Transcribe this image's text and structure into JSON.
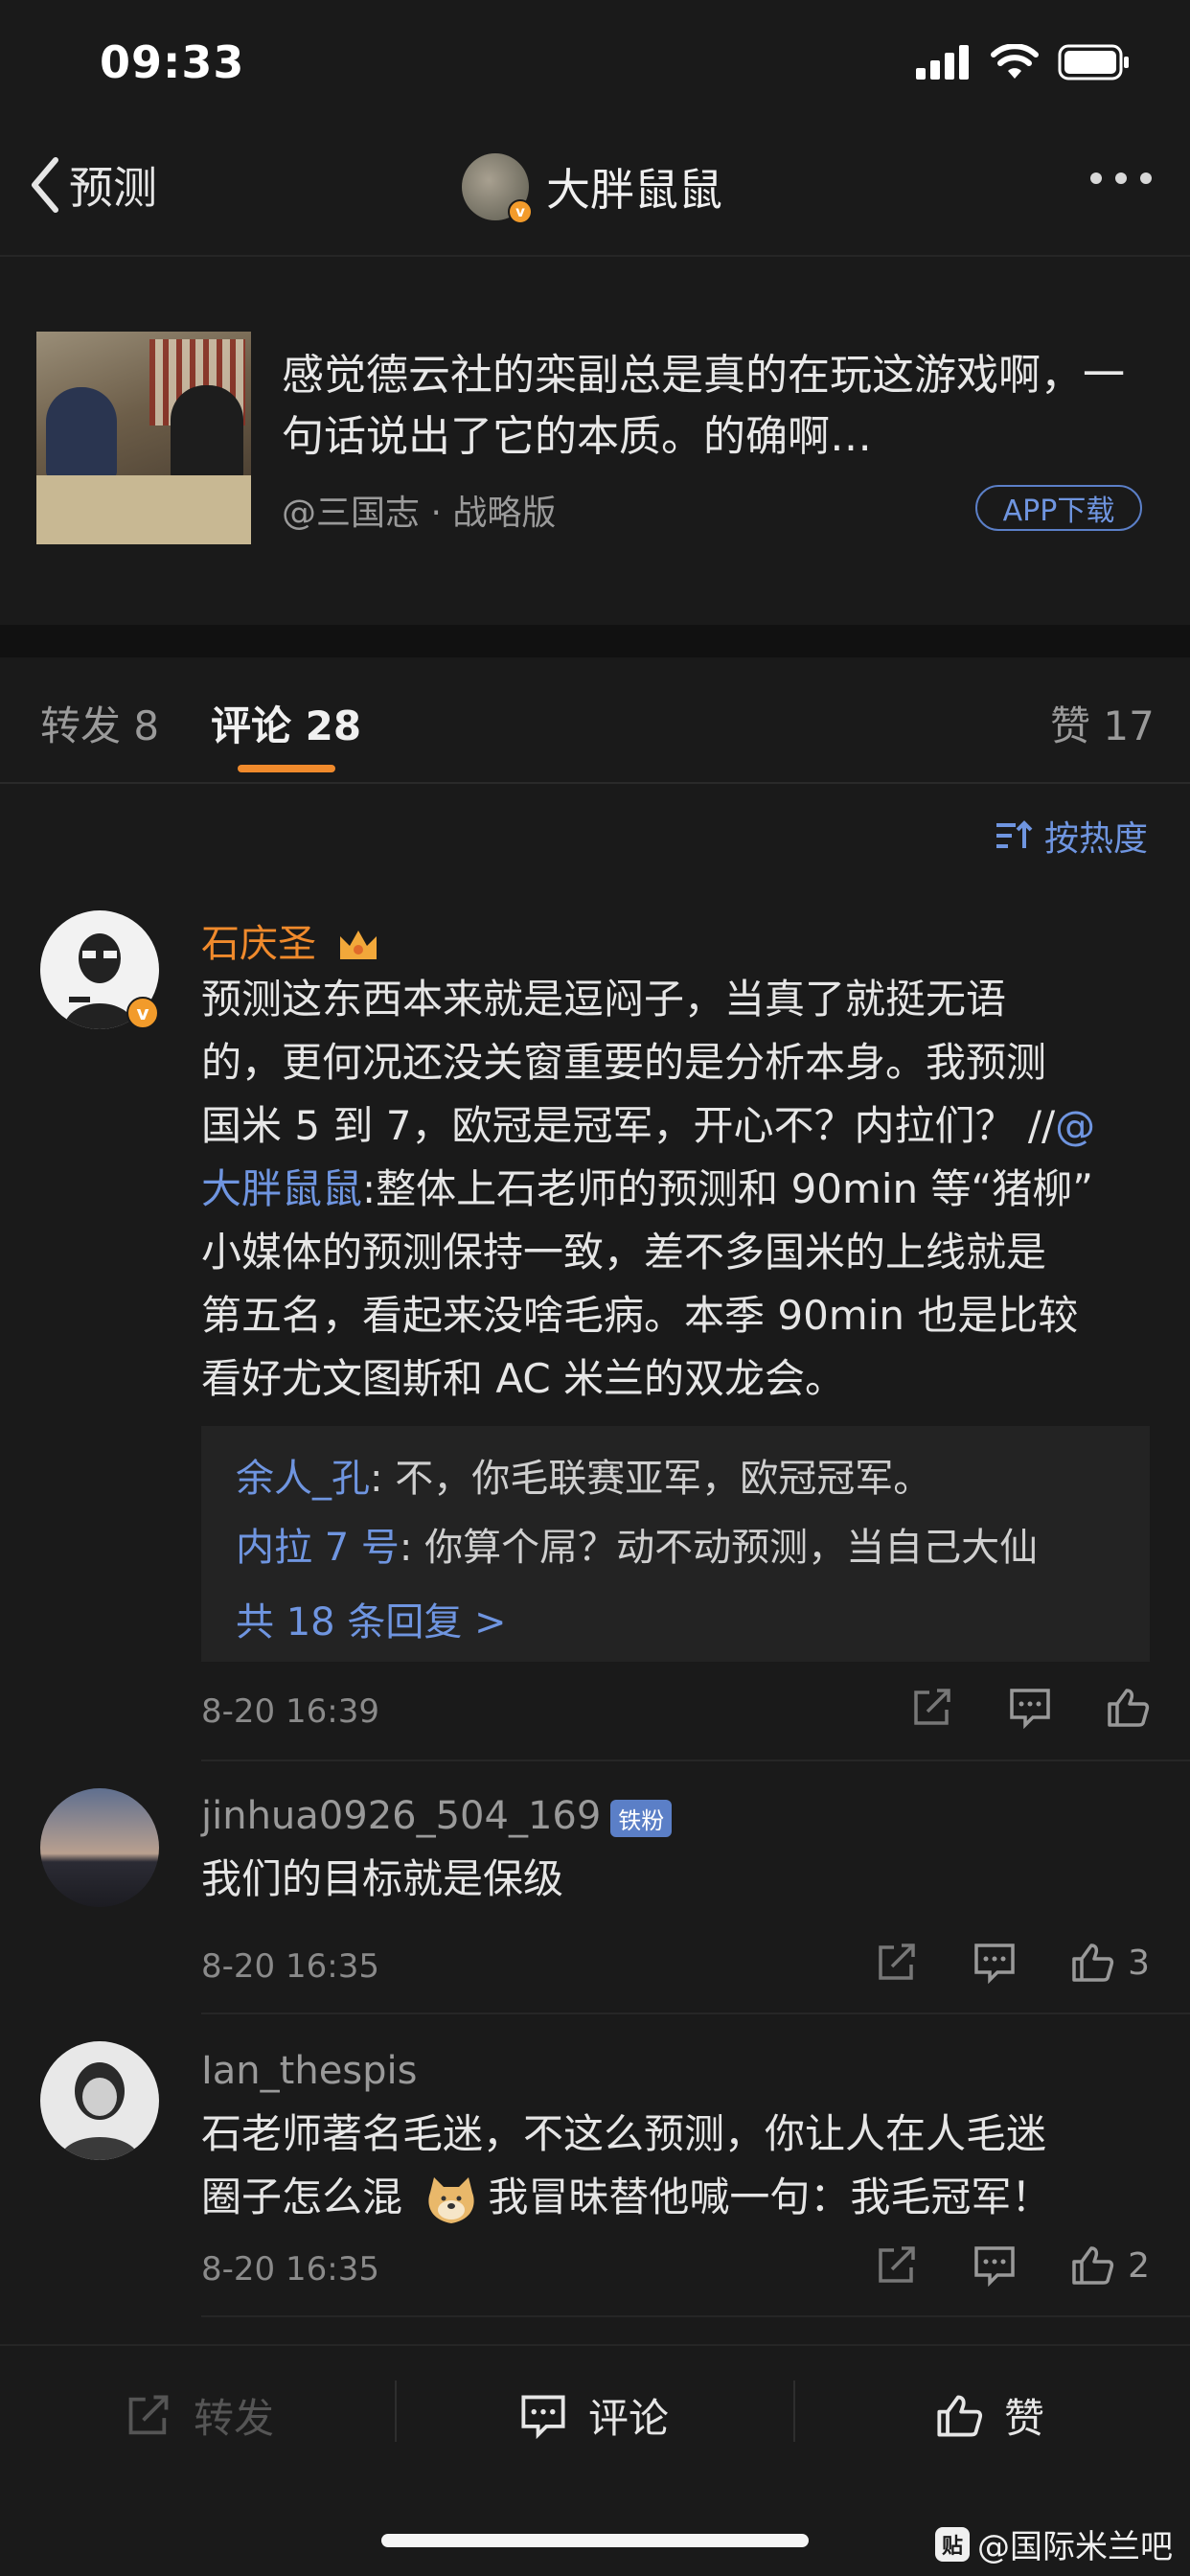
{
  "status": {
    "time": "09:33"
  },
  "nav": {
    "back_label": "预测",
    "username": "大胖鼠鼠"
  },
  "card": {
    "text": "感觉德云社的栾副总是真的在玩这游戏啊，一句话说出了它的本质。的确啊…",
    "source": "@三国志 · 战略版",
    "app_button": "APP下载"
  },
  "tabs": {
    "repost": "转发 8",
    "comments": "评论 28",
    "likes": "赞 17"
  },
  "sort": {
    "label": "按热度"
  },
  "comments": [
    {
      "name": "石庆圣",
      "body_lines": [
        "预测这东西本来就是逗闷子，当真了就挺无语",
        "的，更何况还没关窗重要的是分析本身。我预测",
        "国米 5 到 7，欧冠是冠军，开心不？内拉们？ //",
        "大胖鼠鼠",
        ":整体上石老师的预测和 90min 等“猪柳”",
        "小媒体的预测保持一致，差不多国米的上线就是",
        "第五名，看起来没啥毛病。本季 90min 也是比较",
        "看好尤文图斯和 AC 米兰的双龙会。"
      ],
      "mention_prefix": "@",
      "replies": [
        {
          "who": "余人_孔",
          "text": ": 不，你毛联赛亚军，欧冠冠军。"
        },
        {
          "who": "内拉 7 号",
          "text": ": 你算个屌？动不动预测，当自己大仙"
        }
      ],
      "more_replies": "共 18 条回复 >",
      "time": "8-20 16:39"
    },
    {
      "name": "jinhua0926_504_169",
      "badge": "铁粉",
      "body": "我们的目标就是保级",
      "time": "8-20 16:35",
      "likes": "3"
    },
    {
      "name": "Ian_thespis",
      "body_lines": [
        "石老师著名毛迷，不这么预测，你让人在人毛迷",
        "圈子怎么混",
        "我冒昧替他喊一句：我毛冠军！"
      ],
      "time": "8-20 16:35",
      "likes": "2"
    }
  ],
  "bottom": {
    "repost": "转发",
    "comment": "评论",
    "like": "赞"
  },
  "watermark": {
    "logo": "贴",
    "text": "@国际米兰吧"
  },
  "colors": {
    "accent_orange": "#f08a2c",
    "link_blue": "#6f95e0",
    "background": "#1a1a1a"
  }
}
